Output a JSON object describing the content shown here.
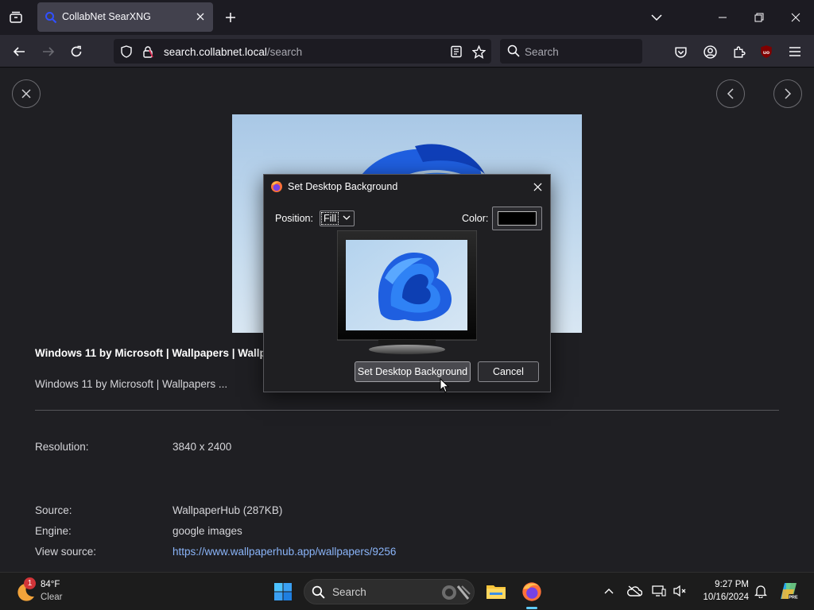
{
  "browser": {
    "tab": {
      "title": "CollabNet SearXNG"
    },
    "url": {
      "host": "search.collabnet.local",
      "path": "/search"
    },
    "search": {
      "placeholder": "Search"
    }
  },
  "result": {
    "title": "Windows 11 by Microsoft | Wallpapers | Wallp",
    "description": "Windows 11 by Microsoft | Wallpapers ...",
    "resolution_label": "Resolution:",
    "resolution_value": "3840 x 2400",
    "source_label": "Source:",
    "source_value": "WallpaperHub (287KB)",
    "engine_label": "Engine:",
    "engine_value": "google images",
    "view_source_label": "View source:",
    "view_source_value": "https://www.wallpaperhub.app/wallpapers/9256"
  },
  "dialog": {
    "title": "Set Desktop Background",
    "position_label": "Position:",
    "position_value": "Fill",
    "color_label": "Color:",
    "color_value": "#000000",
    "primary_button": "Set Desktop Background",
    "cancel_button": "Cancel"
  },
  "taskbar": {
    "weather_badge": "1",
    "weather_temp": "84°F",
    "weather_condition": "Clear",
    "search_placeholder": "Search",
    "time": "9:27 PM",
    "date": "10/16/2024"
  },
  "icons": {
    "tabs": [
      "tab-list-icon",
      "searxng-favicon",
      "close-icon",
      "plus-icon",
      "chevron-down-icon"
    ],
    "window": [
      "minimize-icon",
      "restore-icon",
      "close-icon"
    ],
    "nav": [
      "back-icon",
      "forward-icon",
      "reload-icon",
      "shield-icon",
      "lock-icon",
      "reader-view-icon",
      "star-icon",
      "search-icon"
    ],
    "toolbar": [
      "pocket-icon",
      "account-icon",
      "extensions-icon",
      "ublock-icon",
      "menu-icon"
    ],
    "taskbar": [
      "windows-start-icon",
      "search-icon",
      "file-explorer-icon",
      "firefox-icon",
      "chevron-up-icon",
      "onedrive-icon",
      "network-icon",
      "volume-muted-icon",
      "bell-icon",
      "copilot-icon"
    ]
  },
  "colors": {
    "accent": "#60cdff",
    "link": "#8ab4f8",
    "badge": "#d13438",
    "ublock": "#800000"
  }
}
